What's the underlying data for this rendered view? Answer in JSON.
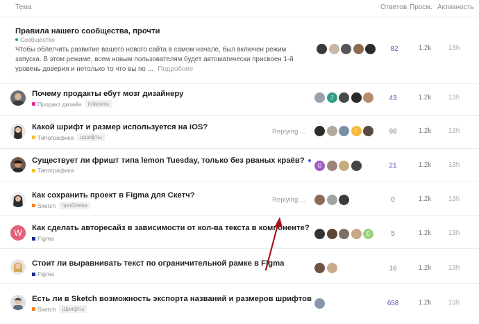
{
  "header": {
    "topic": "Тема",
    "replies": "Ответов",
    "views": "Просм.",
    "activity": "Активность"
  },
  "pinned": {
    "title": "Правила нашего сообщества, прочти",
    "category": "Сообщество",
    "category_color": "#2aa1a4",
    "excerpt": "Чтобы облегчить развитие вашего нового сайта в самом начале, был включен режим запуска. В этом режиме, всем новым пользователям будет автоматически присвоен 1-й уровень доверия и нетолько то что вы по ...",
    "read_more": "Подробнее",
    "replies": "82",
    "views": "1.2k",
    "activity": "13h"
  },
  "topics": [
    {
      "title": "Почему продакты ебут мозг дизайнеру",
      "category": "Продакт дизайн",
      "category_color": "#e0339a",
      "tag": "плагины",
      "replies": "43",
      "views": "1.2k",
      "activity": "13h",
      "replying": ""
    },
    {
      "title": "Какой шрифт и размер используется на iOS?",
      "category": "Типографика",
      "category_color": "#f2c230",
      "tag": "шрифты",
      "replies": "98",
      "views": "1.2k",
      "activity": "13h",
      "replying": "Replying ..."
    },
    {
      "title": "Существует ли фришт типа lemon Tuesday, только без рваных краёв?",
      "category": "Типографика",
      "category_color": "#f2c230",
      "tag": "",
      "replies": "21",
      "views": "1.2k",
      "activity": "13h",
      "replying": ""
    },
    {
      "title": "Как сохранить проект в Figma для Скетч?",
      "category": "Sketch",
      "category_color": "#f58220",
      "tag": "проблема",
      "replies": "0",
      "views": "1.2k",
      "activity": "13h",
      "replying": "Replying ..."
    },
    {
      "title": "Как сделать авторесайз в зависимости от кол-ва текста в компоненте?",
      "category": "Figma",
      "category_color": "#1b2a8e",
      "tag": "",
      "replies": "5",
      "views": "1.2k",
      "activity": "13h",
      "replying": ""
    },
    {
      "title": "Стоит ли выравнивать текст по ограничительной рамке в Figma",
      "category": "Figma",
      "category_color": "#1b2a8e",
      "tag": "",
      "replies": "16",
      "views": "1.2k",
      "activity": "13h",
      "replying": ""
    },
    {
      "title": "Есть ли в Sketch возможность экспорта названий и размеров шрифтов",
      "category": "Sketch",
      "category_color": "#f58220",
      "tag": "Шрифты",
      "replies": "658",
      "views": "1.2k",
      "activity": "13h",
      "replying": ""
    }
  ],
  "letter_avatar": "W",
  "poster_letters": [
    "J",
    "F",
    "G",
    "E"
  ],
  "colors": {
    "accent": "#5d4ec0",
    "arrow": "#a8141c",
    "unread_dot": "#4d5dd8"
  }
}
